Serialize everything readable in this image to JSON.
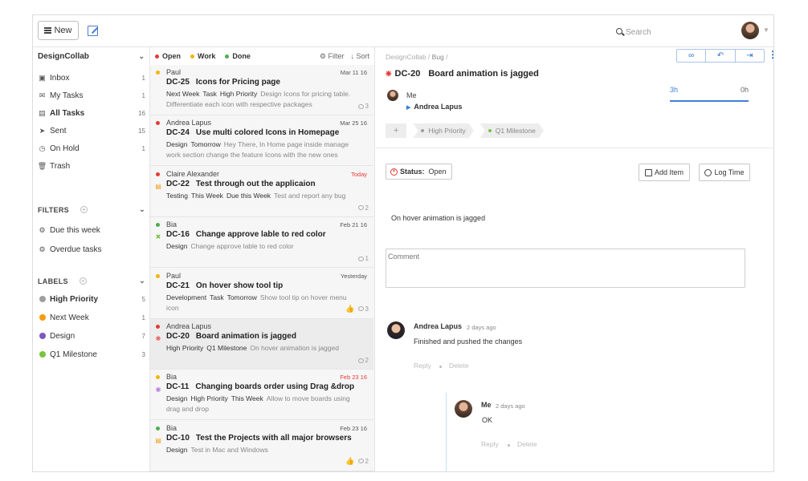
{
  "topbar": {
    "new_label": "New",
    "search_placeholder": "Search"
  },
  "sidebar": {
    "workspace": "DesignCollab",
    "items": [
      {
        "label": "Inbox",
        "count": "1",
        "icon": "inbox-icon"
      },
      {
        "label": "My Tasks",
        "count": "1",
        "icon": "envelope-icon"
      },
      {
        "label": "All Tasks",
        "count": "16",
        "icon": "stack-icon"
      },
      {
        "label": "Sent",
        "count": "15",
        "icon": "send-icon"
      },
      {
        "label": "On Hold",
        "count": "1",
        "icon": "clock-icon"
      },
      {
        "label": "Trash",
        "count": "",
        "icon": "trash-icon"
      }
    ],
    "filters_title": "FILTERS",
    "filters": [
      {
        "label": "Due this week"
      },
      {
        "label": "Overdue tasks"
      }
    ],
    "labels_title": "LABELS",
    "labels": [
      {
        "label": "High Priority",
        "count": "5",
        "color": "#9e9e9e"
      },
      {
        "label": "Next Week",
        "count": "1",
        "color": "#f39c12"
      },
      {
        "label": "Design",
        "count": "7",
        "color": "#7e57c2"
      },
      {
        "label": "Q1 Milestone",
        "count": "3",
        "color": "#7cc242"
      }
    ]
  },
  "list": {
    "legend": [
      {
        "label": "Open",
        "color": "#e53935"
      },
      {
        "label": "Work",
        "color": "#f2b30c"
      },
      {
        "label": "Done",
        "color": "#4caf50"
      }
    ],
    "filter_label": "Filter",
    "sort_label": "Sort",
    "tasks": [
      {
        "who": "Paul",
        "when": "Mar 11 16",
        "code": "DC-25",
        "title": "Icons for Pricing page",
        "tags": [
          "Next Week",
          "Task",
          "High Priority"
        ],
        "desc": "Design Icons for pricing table. Differentiate each icon with respective packages",
        "comments": "3",
        "status_color": "#f2b30c",
        "likes": "",
        "icon": ""
      },
      {
        "who": "Andrea Lapus",
        "when": "Mar 25 16",
        "code": "DC-24",
        "title": "Use multi colored Icons in Homepage",
        "tags": [
          "Design",
          "Tomorrow"
        ],
        "desc": "Hey There, In Home page inside manage work section change the feature Icons with the new ones",
        "comments": "",
        "status_color": "#e53935",
        "likes": "",
        "icon": ""
      },
      {
        "who": "Claire Alexander",
        "when": "Today",
        "code": "DC-22",
        "title": "Test through out the applicaion",
        "tags": [
          "Testing",
          "This Week",
          "Due this Week"
        ],
        "desc": "Test and report any bug",
        "comments": "2",
        "status_color": "#e53935",
        "likes": "",
        "icon": "doc"
      },
      {
        "who": "Bia",
        "when": "Feb 21 16",
        "code": "DC-16",
        "title": "Change approve lable to red color",
        "tags": [
          "Design"
        ],
        "desc": "Change approve lable to red color",
        "comments": "1",
        "status_color": "#4caf50",
        "likes": "",
        "icon": "tools"
      },
      {
        "who": "Paul",
        "when": "Yesterday",
        "code": "DC-21",
        "title": "On hover show tool tip",
        "tags": [
          "Development",
          "Task",
          "Tomorrow"
        ],
        "desc": "Show tool tip on hover menu icon",
        "comments": "3",
        "status_color": "#f2b30c",
        "likes": "liked",
        "icon": ""
      },
      {
        "who": "Andrea Lapus",
        "when": "",
        "code": "DC-20",
        "title": "Board animation is jagged",
        "tags": [
          "High Priority",
          "Q1 Milestone"
        ],
        "desc": "On hover animation is jagged",
        "comments": "2",
        "status_color": "#e53935",
        "likes": "",
        "icon": "bug"
      },
      {
        "who": "Bia",
        "when": "Feb 23 16",
        "code": "DC-11",
        "title": "Changing boards order using Drag &drop",
        "tags": [
          "Design",
          "High Priority",
          "This Week"
        ],
        "desc": "Allow to move boards using drag and drop",
        "comments": "",
        "status_color": "#f2b30c",
        "likes": "",
        "icon": "bulb"
      },
      {
        "who": "Bia",
        "when": "Feb 23 16",
        "code": "DC-10",
        "title": "Test the Projects with all major browsers",
        "tags": [
          "Design"
        ],
        "desc": "Test in Mac and Windows",
        "comments": "2",
        "status_color": "#4caf50",
        "likes": "liked",
        "icon": "doc"
      }
    ]
  },
  "detail": {
    "crumb_workspace": "DesignCollab",
    "crumb_type": "Bug",
    "code": "DC-20",
    "title": "Board animation is jagged",
    "creator": "Me",
    "assignee": "Andrea Lapus",
    "time_spent": "3h",
    "time_left": "0h",
    "chip_add": "+",
    "chips": [
      {
        "label": "High Priority",
        "color": "#9e9e9e"
      },
      {
        "label": "Q1 Milestone",
        "color": "#7cc242"
      }
    ],
    "status_label": "Status:",
    "status_value": "Open",
    "add_item_label": "Add Item",
    "log_time_label": "Log Time",
    "description": "On hover animation is jagged",
    "comment_placeholder": "Comment",
    "comments": [
      {
        "author": "Andrea Lapus",
        "time": "2 days ago",
        "text": "Finished and pushed the changes",
        "reply": "Reply",
        "delete": "Delete"
      },
      {
        "author": "Me",
        "time": "2 days ago",
        "text": "OK",
        "reply": "Reply",
        "delete": "Delete"
      }
    ]
  }
}
